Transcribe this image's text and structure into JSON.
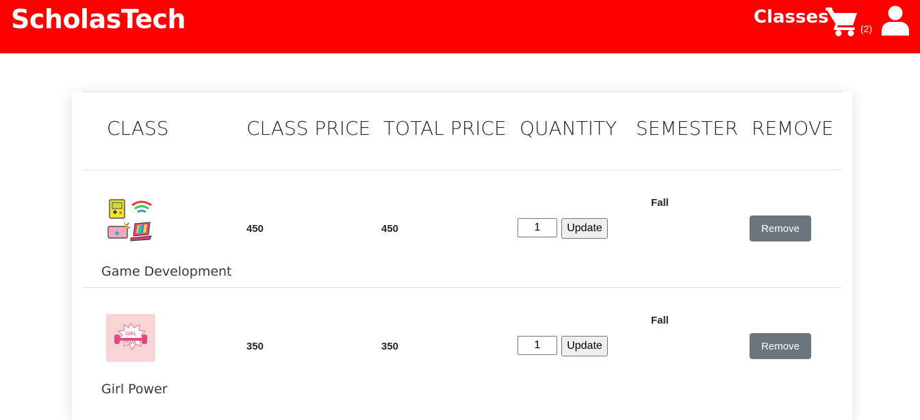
{
  "brand": "ScholasTech",
  "nav": {
    "classes_label": "Classes",
    "cart_count": "(2)"
  },
  "colors": {
    "header_bg": "#ff0000",
    "remove_button": "#6c757d",
    "update_button": "#efefef"
  },
  "icons": {
    "cart": "shopping-cart-icon",
    "user": "user-icon"
  },
  "table": {
    "headers": [
      "CLASS",
      "CLASS PRICE",
      "TOTAL PRICE",
      "QUANTITY",
      "SEMESTER",
      "REMOVE"
    ],
    "rows": [
      {
        "name": "Game Development",
        "class_price": "450",
        "total_price": "450",
        "quantity": "1",
        "update_label": "Update",
        "semester": "Fall",
        "remove_label": "Remove"
      },
      {
        "name": "Girl Power",
        "class_price": "350",
        "total_price": "350",
        "quantity": "1",
        "update_label": "Update",
        "semester": "Fall",
        "remove_label": "Remove"
      }
    ]
  }
}
